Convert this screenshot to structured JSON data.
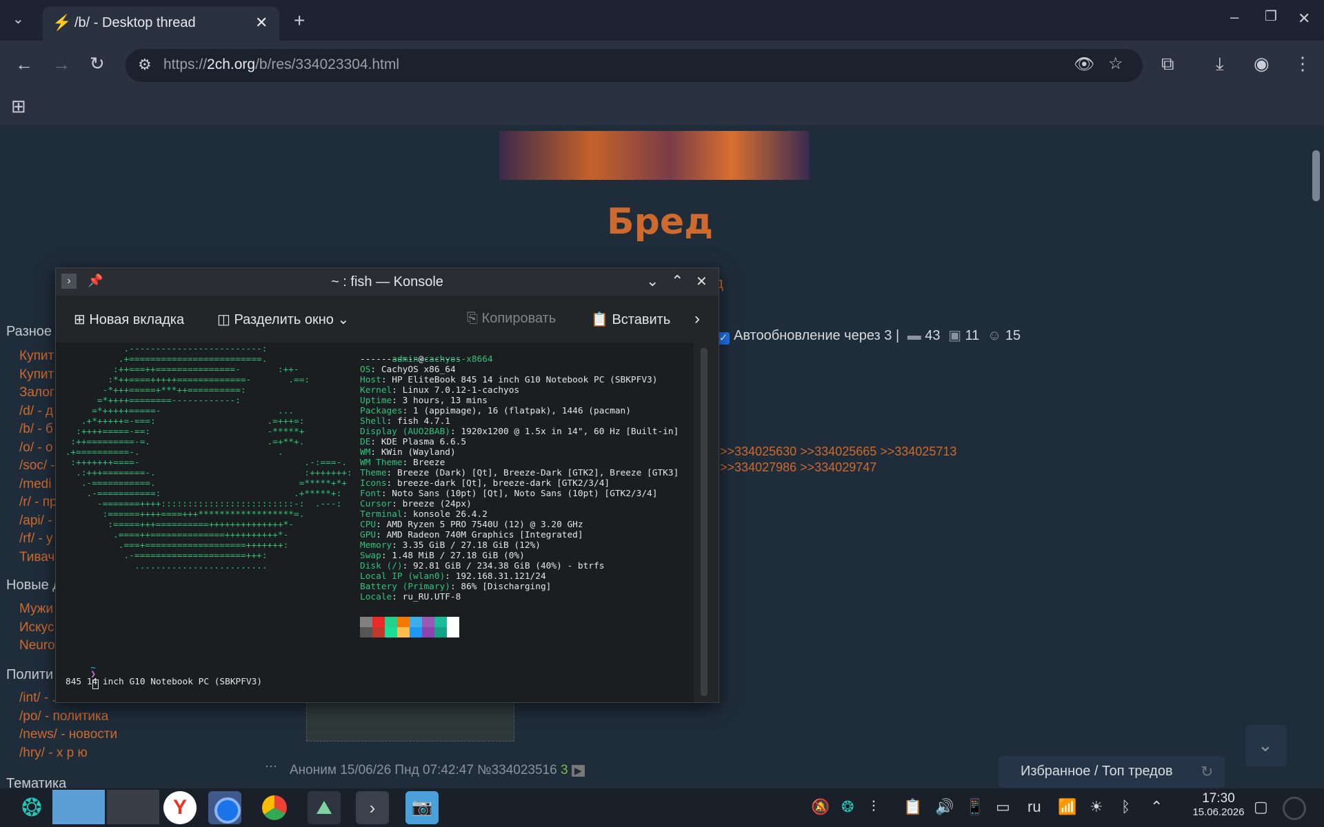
{
  "browser": {
    "tab_title": "/b/ - Desktop thread",
    "url_scheme": "https://",
    "url_host": "2ch.org",
    "url_path": "/b/res/334023304.html",
    "new_tab_glyph": "+",
    "icons": [
      "back-icon",
      "forward-icon",
      "reload-icon",
      "site-settings-icon",
      "tracking-eye-off-icon",
      "star-icon",
      "extensions-icon",
      "download-icon",
      "profile-icon",
      "menu-icon",
      "apps-grid-icon"
    ]
  },
  "page": {
    "board_title": "Бред",
    "auto_update": "Автообновление через 3 |",
    "stats": {
      "posts": "43",
      "images": "11",
      "posters": "15"
    },
    "reply_links_1": ">>334025630 >>334025665 >>334025713",
    "reply_links_2": ">>334027986 >>334029747",
    "sidebar": {
      "group1": "Разное",
      "group1_items": [
        "Купит",
        "Купит",
        "Залог",
        "/d/ - д",
        "/b/ - б",
        "/o/ - о",
        "/soc/ -",
        "/medi",
        "/r/ - пр",
        "/api/ -",
        "/rf/ - у",
        "Тивач"
      ],
      "group2": "Новые д",
      "group2_items": [
        "Мужи",
        "Искус",
        "Neuro"
      ],
      "group3": "Полити",
      "group3_items": [
        "/int/ - ...",
        "/po/ - политика",
        "/news/ - новости",
        "/hry/ - х р ю"
      ],
      "group4": "Тематика"
    },
    "post_meta": {
      "author": "Аноним",
      "date": "15/06/26 Пнд 07:42:47",
      "number": "№334023516",
      "replies": "3"
    },
    "fav_label": "Избранное / Топ тредов"
  },
  "konsole": {
    "title": "~ : fish — Konsole",
    "new_tab": "Новая вкладка",
    "split": "Разделить окно",
    "copy": "Копировать",
    "paste": "Вставить",
    "user": "admin",
    "at": "@",
    "host": "cachyos-x8664",
    "separator": "-------------------",
    "info": [
      {
        "k": "OS",
        "v": ": CachyOS x86_64"
      },
      {
        "k": "Host",
        "v": ": HP EliteBook 845 14 inch G10 Notebook PC (SBKPFV3)"
      },
      {
        "k": "Kernel",
        "v": ": Linux 7.0.12-1-cachyos"
      },
      {
        "k": "Uptime",
        "v": ": 3 hours, 13 mins"
      },
      {
        "k": "Packages",
        "v": ": 1 (appimage), 16 (flatpak), 1446 (pacman)"
      },
      {
        "k": "Shell",
        "v": ": fish 4.7.1"
      },
      {
        "k": "Display (AUO2BAB)",
        "v": ": 1920x1200 @ 1.5x in 14\", 60 Hz [Built-in]"
      },
      {
        "k": "DE",
        "v": ": KDE Plasma 6.6.5"
      },
      {
        "k": "WM",
        "v": ": KWin (Wayland)"
      },
      {
        "k": "WM Theme",
        "v": ": Breeze"
      },
      {
        "k": "Theme",
        "v": ": Breeze (Dark) [Qt], Breeze-Dark [GTK2], Breeze [GTK3]"
      },
      {
        "k": "Icons",
        "v": ": breeze-dark [Qt], breeze-dark [GTK2/3/4]"
      },
      {
        "k": "Font",
        "v": ": Noto Sans (10pt) [Qt], Noto Sans (10pt) [GTK2/3/4]"
      },
      {
        "k": "Cursor",
        "v": ": breeze (24px)"
      },
      {
        "k": "Terminal",
        "v": ": konsole 26.4.2"
      },
      {
        "k": "CPU",
        "v": ": AMD Ryzen 5 PRO 7540U (12) @ 3.20 GHz"
      },
      {
        "k": "GPU",
        "v": ": AMD Radeon 740M Graphics [Integrated]"
      },
      {
        "k": "Memory",
        "v": ": 3.35 GiB / 27.18 GiB (12%)"
      },
      {
        "k": "Swap",
        "v": ": 1.48 MiB / 27.18 GiB (0%)"
      },
      {
        "k": "Disk (/)",
        "v": ": 92.81 GiB / 234.38 GiB (40%) - btrfs"
      },
      {
        "k": "Local IP (wlan0)",
        "v": ": 192.168.31.121/24"
      },
      {
        "k": "Battery (Primary)",
        "v": ": 86% [Discharging]"
      },
      {
        "k": "Locale",
        "v": ": ru_RU.UTF-8"
      }
    ],
    "ascii": [
      "            .-------------------------:",
      "           .+=========================.",
      "          :++===++===============-       :++-",
      "         :*++====+++++=============-       .==:",
      "        -*+++=====+***++==========:",
      "       =*++++========------------:",
      "      =*+++++=====-                      ...",
      "    .+*+++++=-===:                     .=+++=:",
      "   :++++=====-==:                      -*****+",
      "  :++=========-=.                      .=+**+.",
      " .+==========-.                          .",
      "  :+++++++====-                               .-:===-.",
      "   .:+++========-.                            :+++++++:",
      "    .-===========.                           =*****+*+",
      "     .-===========:                         .+*****+:",
      "       -=======++++:::::::::::::::::::::::::-:  .---:",
      "        :======++++====+++******************=.",
      "         :=====+++==========++++++++++++++*-",
      "          .====++==============++++++++++*-",
      "           .===+===================+++++++:",
      "            .-=====================+++:",
      "              ........................."
    ],
    "prompt_tilde": "~",
    "prompt_arrow": "❯",
    "status_line": "845 14 inch G10 Notebook PC (SBKPFV3)",
    "palette_top": [
      "#808080",
      "#ef2929",
      "#23d18b",
      "#f57900",
      "#3daee9",
      "#9b59b6",
      "#1abc9c",
      "#ffffff"
    ],
    "palette_bottom": [
      "#555555",
      "#c0392b",
      "#1cdc9a",
      "#fdbc4b",
      "#1d99f3",
      "#8e44ad",
      "#16a085",
      "#ffffff"
    ]
  },
  "taskbar": {
    "lang": "ru",
    "time": "17:30",
    "date": "15.06.2026"
  }
}
